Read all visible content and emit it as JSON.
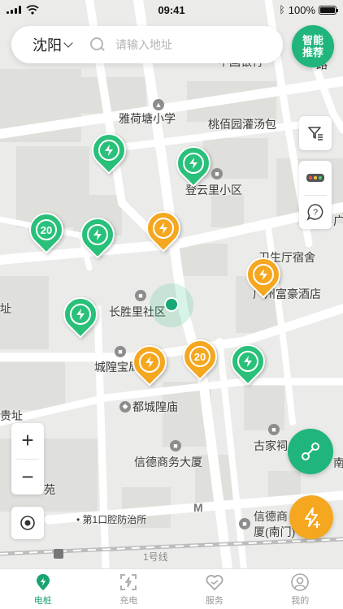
{
  "status": {
    "time": "09:41",
    "battery": "100%",
    "battery_level": 1.0
  },
  "search": {
    "city": "沈阳",
    "placeholder": "请输入地址"
  },
  "smart_button": {
    "label": "智能推荐"
  },
  "map": {
    "labels": {
      "school": "雅荷塘小学",
      "soup": "桃佰园灌汤包",
      "dengyunli": "登云里小区",
      "weisheng": "卫生厅宿舍",
      "hotel": "广州富豪酒店",
      "changsheng": "长胜里社区",
      "chenghuang": "城隍宝局",
      "temple": "都城隍庙",
      "xinde": "信德商务大厦",
      "gujia": "古家祠",
      "clinic": "第1口腔防治所",
      "xinde_south": "信德商",
      "xinde_south2": "厦(南门)",
      "yuan": "苑",
      "gui": "贵址",
      "zhi": "址",
      "line1": "1号线",
      "road": "路",
      "bank": "中国银行",
      "guang": "广",
      "nan": "南"
    },
    "pins": [
      {
        "color": "green",
        "content": "bolt"
      },
      {
        "color": "green",
        "content": "bolt"
      },
      {
        "color": "green",
        "content": "20"
      },
      {
        "color": "green",
        "content": "bolt"
      },
      {
        "color": "orange",
        "content": "bolt"
      },
      {
        "color": "orange",
        "content": "bolt"
      },
      {
        "color": "green",
        "content": "bolt"
      },
      {
        "color": "orange",
        "content": "bolt"
      },
      {
        "color": "orange",
        "content": "20"
      },
      {
        "color": "green",
        "content": "bolt"
      }
    ]
  },
  "tabs": [
    {
      "label": "电桩",
      "icon": "charging-pile-icon",
      "active": true
    },
    {
      "label": "充电",
      "icon": "scan-charge-icon",
      "active": false
    },
    {
      "label": "服务",
      "icon": "service-heart-icon",
      "active": false
    },
    {
      "label": "我的",
      "icon": "profile-icon",
      "active": false
    }
  ],
  "colors": {
    "primary": "#1fb57c",
    "accent": "#f4a71f",
    "pin_green": "#29c07a"
  }
}
